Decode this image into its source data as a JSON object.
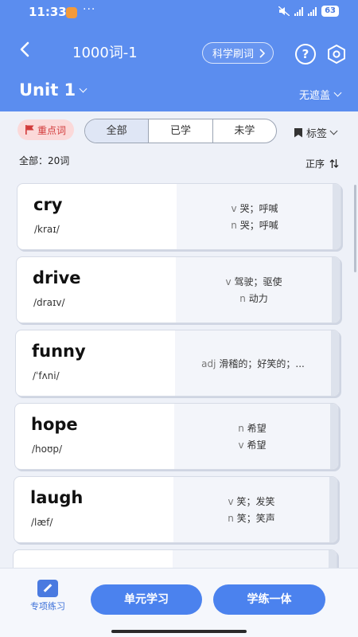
{
  "status_bar": {
    "time": "11:33",
    "dots": "···",
    "battery": "63"
  },
  "header": {
    "title": "1000词-1",
    "mode_button": "科学刷词",
    "help_label": "?",
    "unit": "Unit 1",
    "cover_mode": "无遮盖"
  },
  "filters": {
    "key_words": "重点词",
    "tabs": [
      {
        "label": "全部",
        "active": true
      },
      {
        "label": "已学",
        "active": false
      },
      {
        "label": "未学",
        "active": false
      }
    ],
    "tags": "标签",
    "count": "全部：20词",
    "sort": "正序"
  },
  "words": [
    {
      "word": "cry",
      "phonetic": "/kraɪ/",
      "defs": [
        {
          "pos": "v",
          "text": "哭；呼喊"
        },
        {
          "pos": "n",
          "text": "哭；呼喊"
        }
      ]
    },
    {
      "word": "drive",
      "phonetic": "/draɪv/",
      "defs": [
        {
          "pos": "v",
          "text": "驾驶；驱使"
        },
        {
          "pos": "n",
          "text": "动力"
        }
      ]
    },
    {
      "word": "funny",
      "phonetic": "/ˈfʌni/",
      "defs": [
        {
          "pos": "adj",
          "text": "滑稽的；好笑的；..."
        }
      ]
    },
    {
      "word": "hope",
      "phonetic": "/hoʊp/",
      "defs": [
        {
          "pos": "n",
          "text": "希望"
        },
        {
          "pos": "v",
          "text": "希望"
        }
      ]
    },
    {
      "word": "laugh",
      "phonetic": "/læf/",
      "defs": [
        {
          "pos": "v",
          "text": "笑；发笑"
        },
        {
          "pos": "n",
          "text": "笑；笑声"
        }
      ]
    },
    {
      "word": "",
      "phonetic": "",
      "defs": []
    }
  ],
  "bottom": {
    "practice": "专项练习",
    "unit_study": "单元学习",
    "study_practice": "学练一体"
  },
  "colors": {
    "header": "#5b8def",
    "accent": "#4b82ee",
    "key_words_bg": "#fbd9d9",
    "key_words_fg": "#d23b3b"
  }
}
